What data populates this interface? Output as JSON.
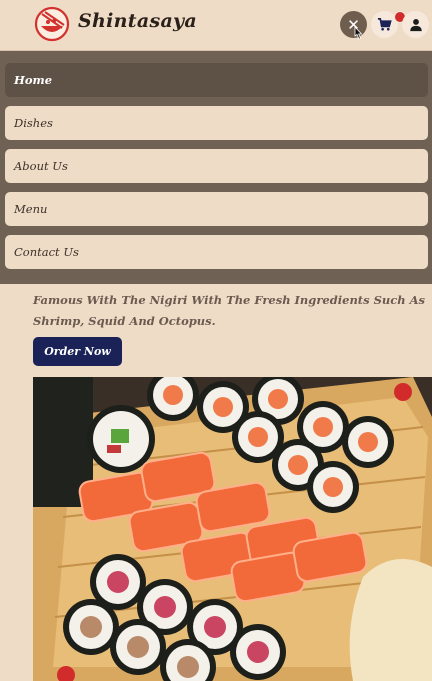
{
  "header": {
    "brand": "Shintasaya",
    "logo_icon": "chopsticks-bowl-logo",
    "close_icon": "close-icon",
    "cart_icon": "cart-icon",
    "user_icon": "user-icon",
    "close_symbol": "✕"
  },
  "nav": {
    "items": [
      {
        "label": "Home",
        "active": true
      },
      {
        "label": "Dishes",
        "active": false
      },
      {
        "label": "About Us",
        "active": false
      },
      {
        "label": "Menu",
        "active": false
      },
      {
        "label": "Contact Us",
        "active": false
      }
    ]
  },
  "hero": {
    "description": "Famous With The Nigiri With The Fresh Ingredients Such As Shrimp, Squid And Octopus.",
    "order_button": "Order Now",
    "image_icon": "sushi-platter-image"
  },
  "colors": {
    "background": "#efdcc6",
    "menu_panel": "#6f6154",
    "active_item": "#5e5246",
    "order_button": "#1a2258",
    "badge": "#d22b2b"
  }
}
